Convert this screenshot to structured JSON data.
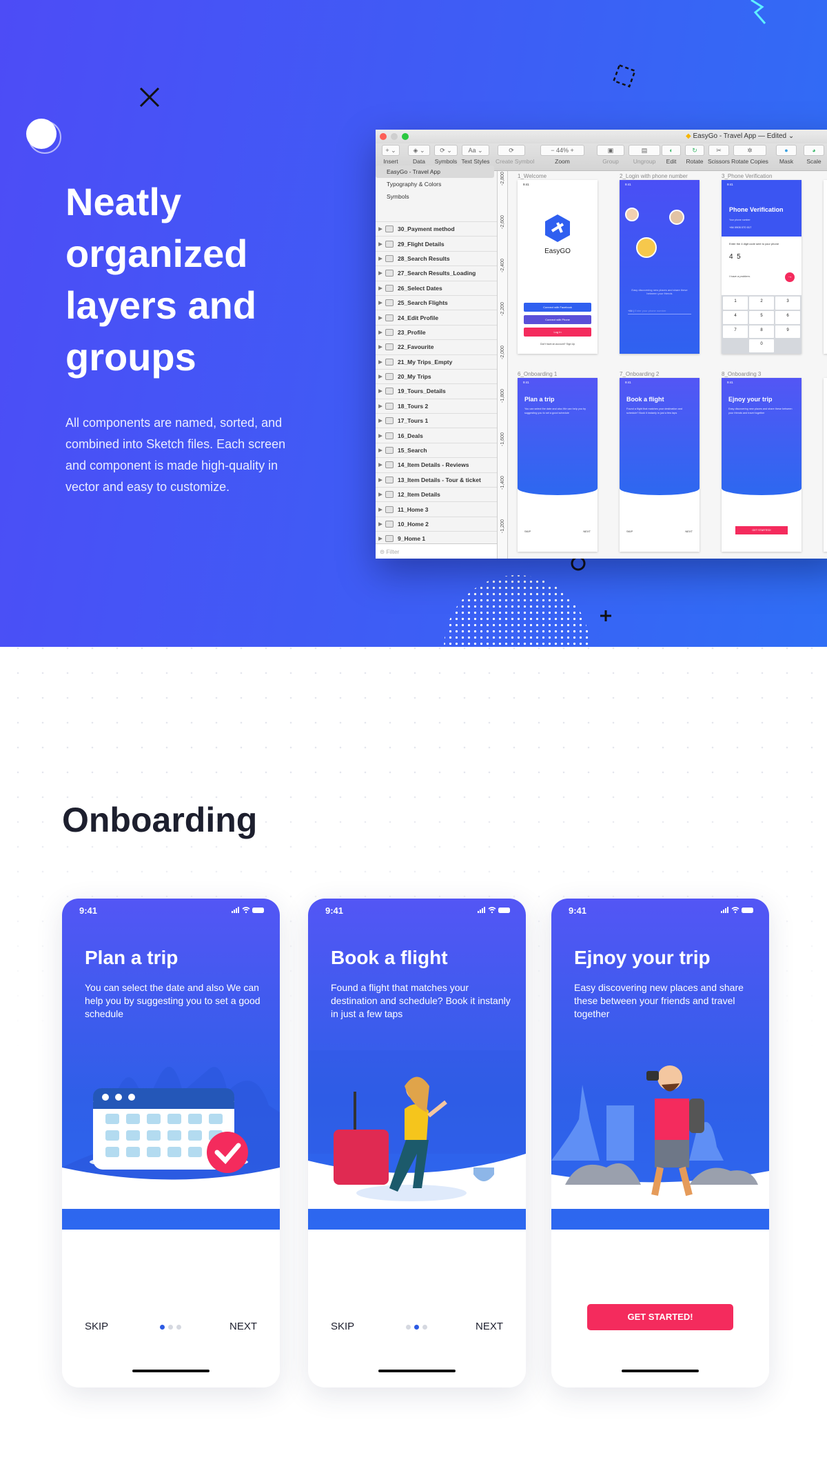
{
  "hero": {
    "heading": "Neatly organized layers and groups",
    "description": "All components are named, sorted, and combined into Sketch files. Each screen and component is made high-quality in vector and easy to customize.",
    "bg_colors": [
      "#4d4cf6",
      "#2f6ef5"
    ]
  },
  "sketch": {
    "doc_title": "EasyGo - Travel App",
    "doc_status": "— Edited",
    "toolbar": [
      {
        "icon": "plus",
        "label": "Insert"
      },
      {
        "icon": "data",
        "label": "Data"
      },
      {
        "icon": "symbol",
        "label": "Symbols"
      },
      {
        "icon": "text-style",
        "btn": "Aa",
        "label": "Text Styles"
      },
      {
        "icon": "create-symbol",
        "label": "Create Symbol"
      },
      {
        "icon": "zoom",
        "btn": "44%",
        "label": "Zoom"
      },
      {
        "icon": "group",
        "label": "Group"
      },
      {
        "icon": "ungroup",
        "label": "Ungroup"
      },
      {
        "icon": "edit",
        "label": "Edit"
      },
      {
        "icon": "rotate",
        "label": "Rotate"
      },
      {
        "icon": "scissors",
        "label": "Scissors"
      },
      {
        "icon": "rotate-copies",
        "label": "Rotate Copies"
      },
      {
        "icon": "mask",
        "label": "Mask"
      },
      {
        "icon": "scale",
        "label": "Scale"
      }
    ],
    "pages": [
      "EasyGo - Travel App",
      "Typography & Colors",
      "Symbols"
    ],
    "layers": [
      "30_Payment method",
      "29_Flight Details",
      "28_Search Results",
      "27_Search Results_Loading",
      "26_Select Dates",
      "25_Search Flights",
      "24_Edit Profile",
      "23_Profile",
      "22_Favourite",
      "21_My Trips_Empty",
      "20_My Trips",
      "19_Tours_Details",
      "18_Tours 2",
      "17_Tours 1",
      "16_Deals",
      "15_Search",
      "14_Item Details - Reviews",
      "13_Item Details - Tour & ticket",
      "12_Item Details",
      "11_Home 3",
      "10_Home 2",
      "9_Home 1"
    ],
    "filter_placeholder": "Filter",
    "ruler": [
      "-2,800",
      "-2,600",
      "-2,400",
      "-2,200",
      "-2,000",
      "-1,800",
      "-1,600",
      "-1,400",
      "-1,200"
    ],
    "artboards": {
      "welcome": {
        "title": "1_Welcome",
        "time": "9:41",
        "brand": "EasyGO",
        "fb": "Connect with Facebook",
        "phone": "Connect with Phone",
        "login": "Log In",
        "signup": "Don't have an account? Sign Up"
      },
      "login": {
        "title": "2_Login with phone number",
        "time": "9:41",
        "text": "Easy discovering new places and share these between your friends",
        "code": "+84",
        "placeholder": "Enter your phone number"
      },
      "verify": {
        "title": "3_Phone Verification",
        "time": "9:41",
        "heading": "Phone Verification",
        "label": "Your phone number",
        "number": "+84  0905 070 017",
        "prompt": "Enter the 4 digit code sent to your phone",
        "digits": [
          "4",
          "5"
        ],
        "problem": "I have a problem.",
        "keys": [
          "1",
          "2",
          "3",
          "4",
          "5",
          "6",
          "7",
          "8",
          "9",
          "0"
        ]
      },
      "ob1": {
        "title": "6_Onboarding 1"
      },
      "ob2": {
        "title": "7_Onboarding 2"
      },
      "ob3": {
        "title": "8_Onboarding 3"
      }
    }
  },
  "onboarding": {
    "section_title": "Onboarding",
    "time": "9:41",
    "cards": [
      {
        "title": "Plan a trip",
        "text": "You can select the date and also We can help you by suggesting you to set a good schedule",
        "skip": "SKIP",
        "next": "NEXT",
        "active_dot": 0
      },
      {
        "title": "Book a flight",
        "text": "Found a flight that matches your destination and schedule? Book it instanly in just a few taps",
        "skip": "SKIP",
        "next": "NEXT",
        "active_dot": 1
      },
      {
        "title": "Ejnoy your trip",
        "text": "Easy discovering new places and share these between your friends and travel together",
        "cta": "GET STARTED!"
      }
    ],
    "accent": "#f42b5d"
  }
}
